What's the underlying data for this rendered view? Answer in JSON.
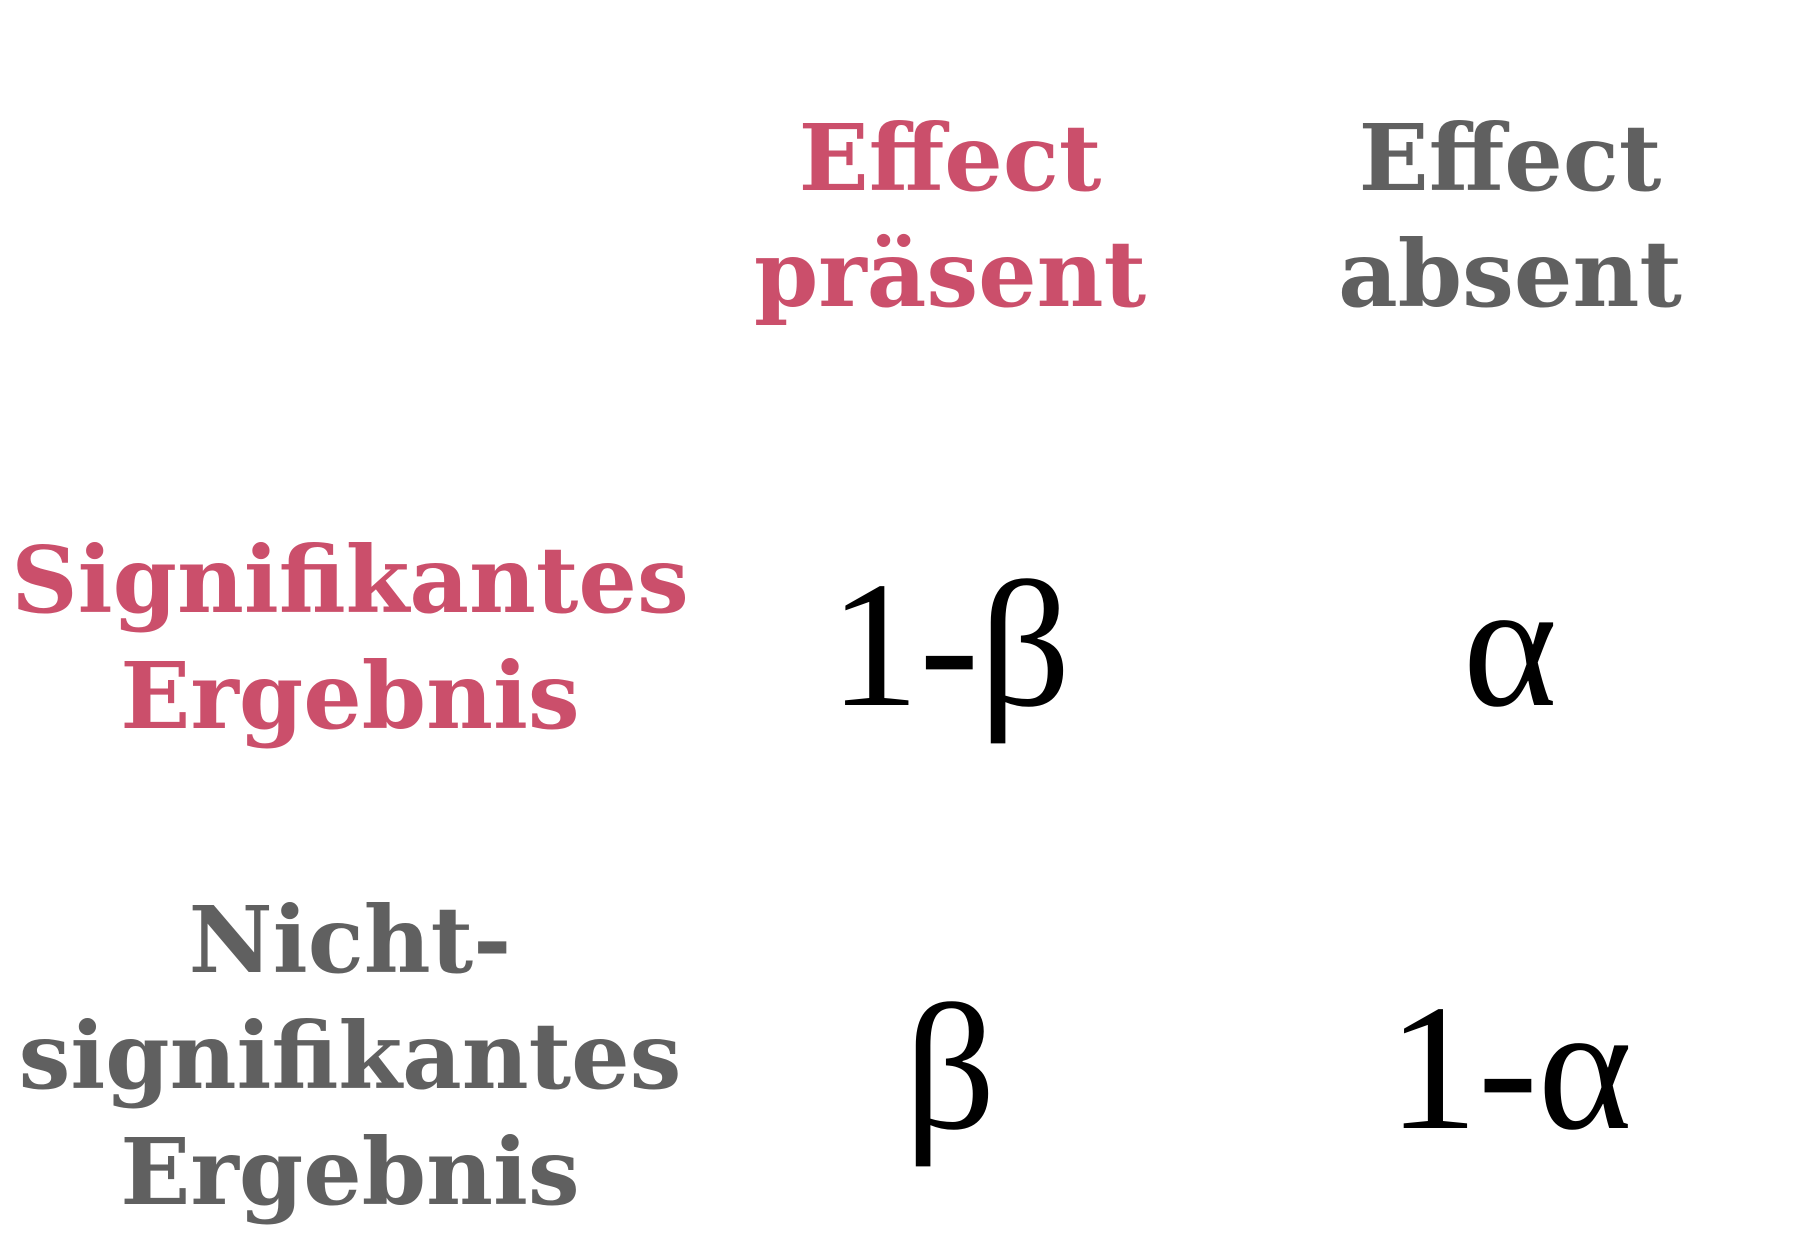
{
  "colors": {
    "highlight": "#cb4f6b",
    "muted": "#606060",
    "symbol": "#000000",
    "background": "#ffffff"
  },
  "columns": [
    {
      "lines": [
        "Effect",
        "präsent"
      ],
      "color": "highlight"
    },
    {
      "lines": [
        "Effect",
        "absent"
      ],
      "color": "muted"
    }
  ],
  "rows": [
    {
      "lines": [
        "Signifikantes",
        "Ergebnis"
      ],
      "color": "highlight"
    },
    {
      "lines": [
        "Nicht-",
        "signifikantes",
        "Ergebnis"
      ],
      "color": "muted"
    }
  ],
  "cells": [
    [
      "1-β",
      "α"
    ],
    [
      "β",
      "1-α"
    ]
  ]
}
